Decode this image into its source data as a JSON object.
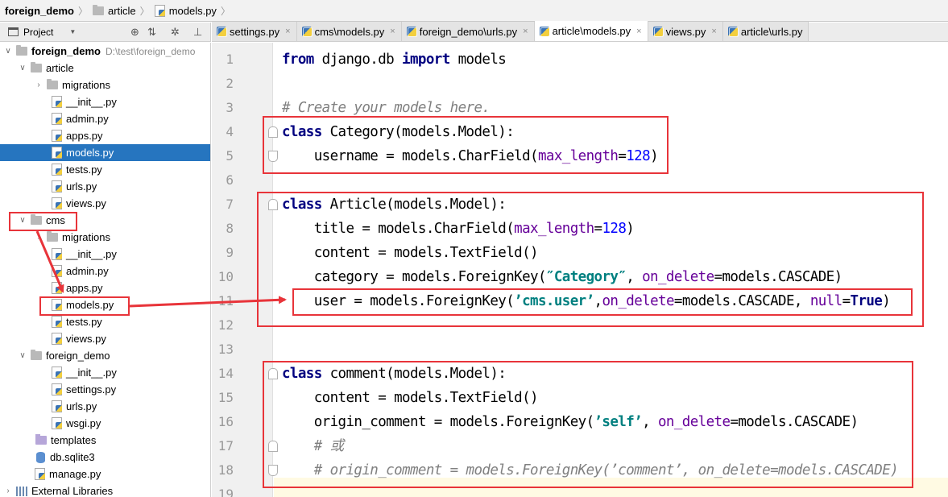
{
  "breadcrumb": {
    "project": "foreign_demo",
    "folder": "article",
    "file": "models.py"
  },
  "project_panel": {
    "title": "Project",
    "toolbar_icons": [
      "target-icon",
      "split-icon",
      "gear-icon",
      "collapse-icon"
    ]
  },
  "tree": {
    "root_label": "foreign_demo",
    "root_path": "D:\\test\\foreign_demo",
    "items": [
      {
        "label": "article"
      },
      {
        "label": "migrations"
      },
      {
        "label": "__init__.py"
      },
      {
        "label": "admin.py"
      },
      {
        "label": "apps.py"
      },
      {
        "label": "models.py"
      },
      {
        "label": "tests.py"
      },
      {
        "label": "urls.py"
      },
      {
        "label": "views.py"
      },
      {
        "label": "cms"
      },
      {
        "label": "migrations"
      },
      {
        "label": "__init__.py"
      },
      {
        "label": "admin.py"
      },
      {
        "label": "apps.py"
      },
      {
        "label": "models.py"
      },
      {
        "label": "tests.py"
      },
      {
        "label": "views.py"
      },
      {
        "label": "foreign_demo"
      },
      {
        "label": "__init__.py"
      },
      {
        "label": "settings.py"
      },
      {
        "label": "urls.py"
      },
      {
        "label": "wsgi.py"
      },
      {
        "label": "templates"
      },
      {
        "label": "db.sqlite3"
      },
      {
        "label": "manage.py"
      },
      {
        "label": "External Libraries"
      }
    ]
  },
  "tabs": [
    {
      "label": "settings.py"
    },
    {
      "label": "cms\\models.py"
    },
    {
      "label": "foreign_demo\\urls.py"
    },
    {
      "label": "article\\models.py"
    },
    {
      "label": "views.py"
    },
    {
      "label": "article\\urls.py"
    }
  ],
  "tab_close_glyph": "×",
  "line_numbers": [
    "1",
    "2",
    "3",
    "4",
    "5",
    "6",
    "7",
    "8",
    "9",
    "10",
    "11",
    "12",
    "13",
    "14",
    "15",
    "16",
    "17",
    "18",
    "19"
  ],
  "code": {
    "l1": {
      "kw1": "from",
      "t1": " django.db ",
      "kw2": "import",
      "t2": " models"
    },
    "l3": {
      "comment": "# Create your models here."
    },
    "l4": {
      "kw": "class",
      "rest": " Category(models.Model):"
    },
    "l5": {
      "t1": "    username = models.CharField(",
      "p": "max_length",
      "eq": "=",
      "n": "128",
      "end": ")"
    },
    "l7": {
      "kw": "class",
      "rest": " Article(models.Model):"
    },
    "l8": {
      "t1": "    title = models.CharField(",
      "p": "max_length",
      "eq": "=",
      "n": "128",
      "end": ")"
    },
    "l9": {
      "t1": "    content = models.TextField()"
    },
    "l10": {
      "t1": "    category = models.ForeignKey(",
      "s": "″Category″",
      "c": ", ",
      "p": "on_delete",
      "end": "=models.CASCADE)"
    },
    "l11": {
      "t1": "    user = models.ForeignKey(",
      "s": "’cms.user’",
      "c": ",",
      "p1": "on_delete",
      "mid": "=models.CASCADE, ",
      "p2": "null",
      "eq": "=",
      "v": "True",
      "end": ")"
    },
    "l14": {
      "kw": "class",
      "rest": " comment(models.Model):"
    },
    "l15": {
      "t1": "    content = models.TextField()"
    },
    "l16": {
      "t1": "    origin_comment = models.ForeignKey(",
      "s": "’self’",
      "c": ", ",
      "p": "on_delete",
      "end": "=models.CASCADE)"
    },
    "l17": {
      "comment": "    # 或"
    },
    "l18": {
      "comment": "    # origin_comment = models.ForeignKey(’comment’, on_delete=models.CASCADE)"
    }
  },
  "colors": {
    "keyword": "#000080",
    "string": "#008080",
    "comment": "#808080",
    "param": "#660099",
    "number": "#0000ff",
    "annotation": "#e8343a",
    "selection": "#2675bf"
  }
}
